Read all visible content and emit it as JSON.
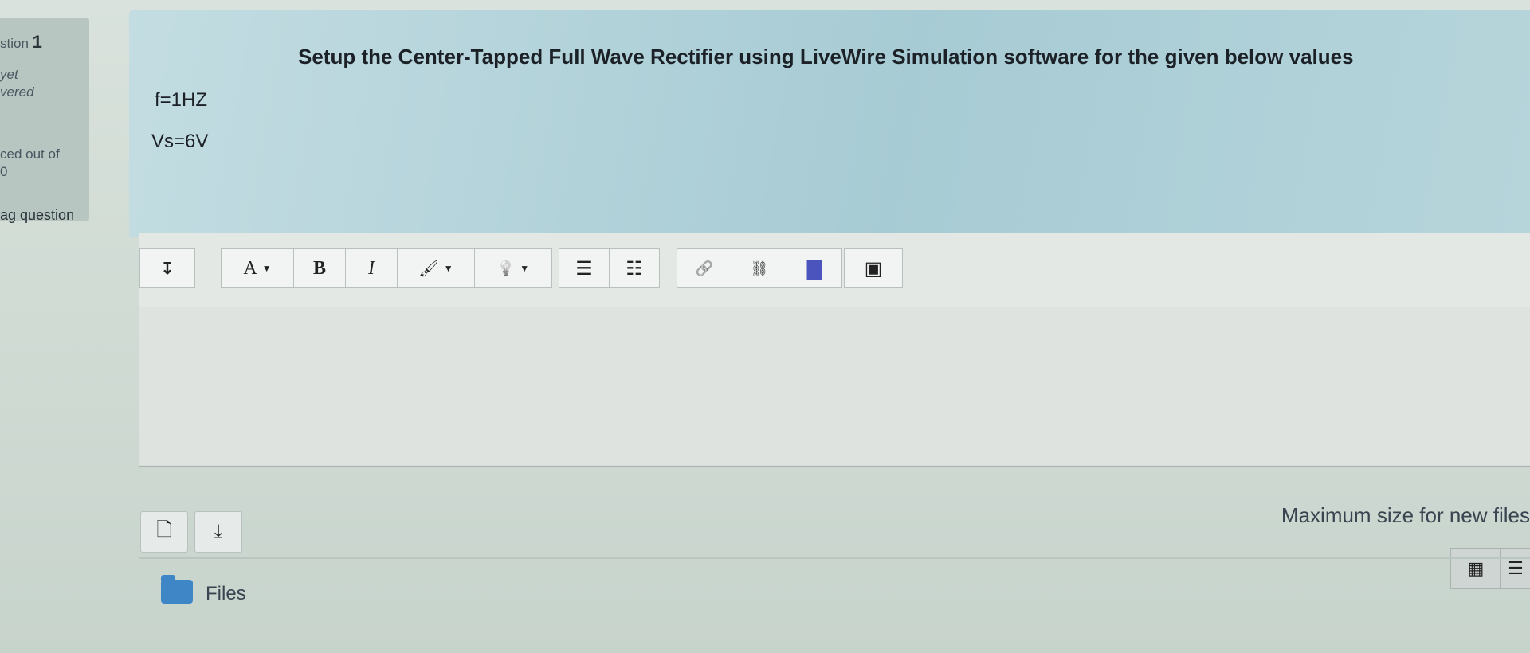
{
  "question_info": {
    "number_prefix": "stion",
    "number": "1",
    "status_line1": "yet",
    "status_line2": "vered",
    "mark_line1": "ced out of",
    "mark_line2": "0",
    "flag_label": "ag question"
  },
  "question": {
    "heading": "Setup the  Center-Tapped Full  Wave  Rectifier using LiveWire Simulation software for the given below values",
    "line1": "f=1HZ",
    "line2": "Vs=6V"
  },
  "editor": {
    "toolbar": {
      "expand_icon": "↧",
      "font_label": "A",
      "bold_label": "B",
      "italic_label": "I",
      "brush_icon": "🖌",
      "bulb_icon": "💡",
      "unordered_list_icon": "☰",
      "ordered_list_icon": "☷",
      "link_icon": "🔗",
      "unlink_icon": "⛓",
      "teams_icon": "▇",
      "image_icon": "▣"
    },
    "content": ""
  },
  "file_picker": {
    "add_file_icon": "🗋",
    "download_icon": "⤓",
    "max_size_text": "Maximum size for new files",
    "grid_view_icon": "▦",
    "list_view_icon": "☰",
    "folder_label": "Files"
  },
  "colors": {
    "question_panel": "#a7cbd4",
    "folder": "#3f86c6",
    "teams": "#4b53bc"
  }
}
